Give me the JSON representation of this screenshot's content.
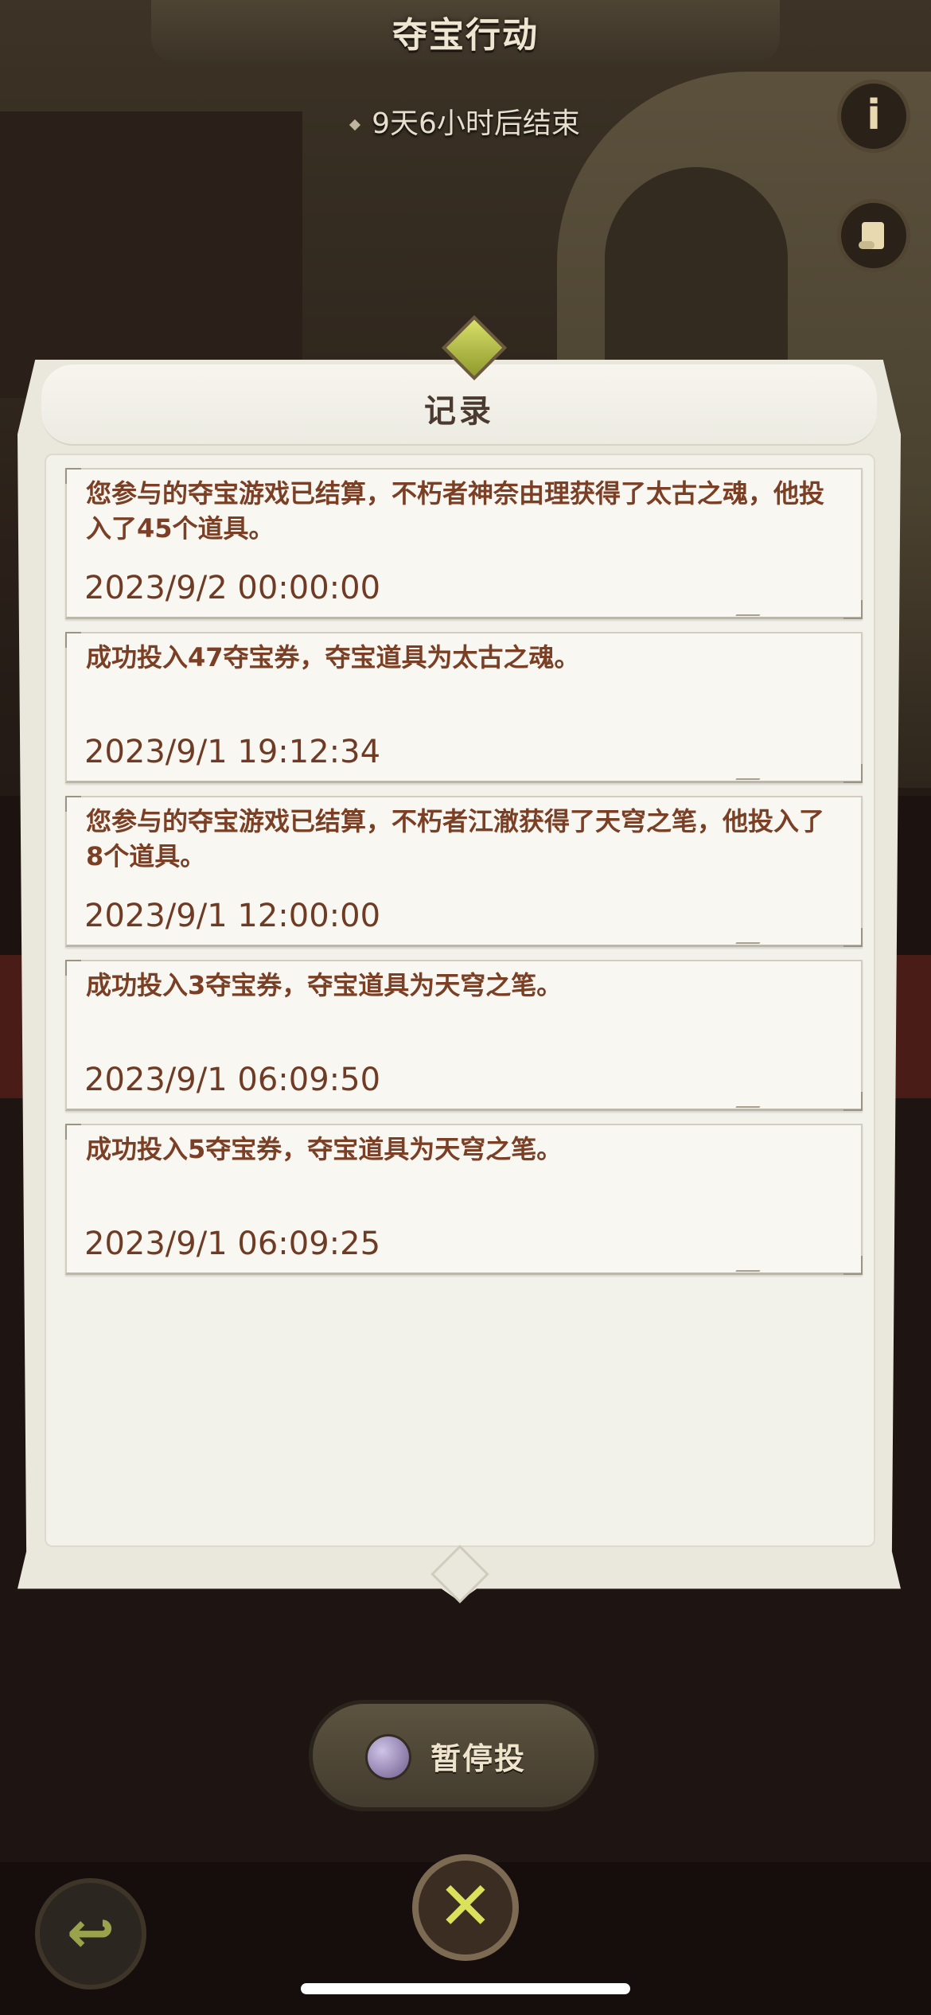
{
  "header": {
    "title": "夺宝行动",
    "countdown": "9天6小时后结束",
    "info_icon_glyph": "i"
  },
  "panel": {
    "title": "记录"
  },
  "records": [
    {
      "message": "您参与的夺宝游戏已结算，不朽者神奈由理获得了太古之魂，他投入了45个道具。",
      "time": "2023/9/2 00:00:00"
    },
    {
      "message": "成功投入47夺宝券，夺宝道具为太古之魂。",
      "time": "2023/9/1 19:12:34"
    },
    {
      "message": "您参与的夺宝游戏已结算，不朽者江澈获得了天穹之笔，他投入了8个道具。",
      "time": "2023/9/1 12:00:00"
    },
    {
      "message": "成功投入3夺宝券，夺宝道具为天穹之笔。",
      "time": "2023/9/1 06:09:50"
    },
    {
      "message": "成功投入5夺宝券，夺宝道具为天穹之笔。",
      "time": "2023/9/1 06:09:25"
    }
  ],
  "controls": {
    "pause_label": "暂停投",
    "close_glyph": "✕",
    "back_glyph": "↩"
  },
  "colors": {
    "record_text": "#7a3f24",
    "panel_bg": "#eae7dc",
    "accent_green": "#d9e25a"
  }
}
